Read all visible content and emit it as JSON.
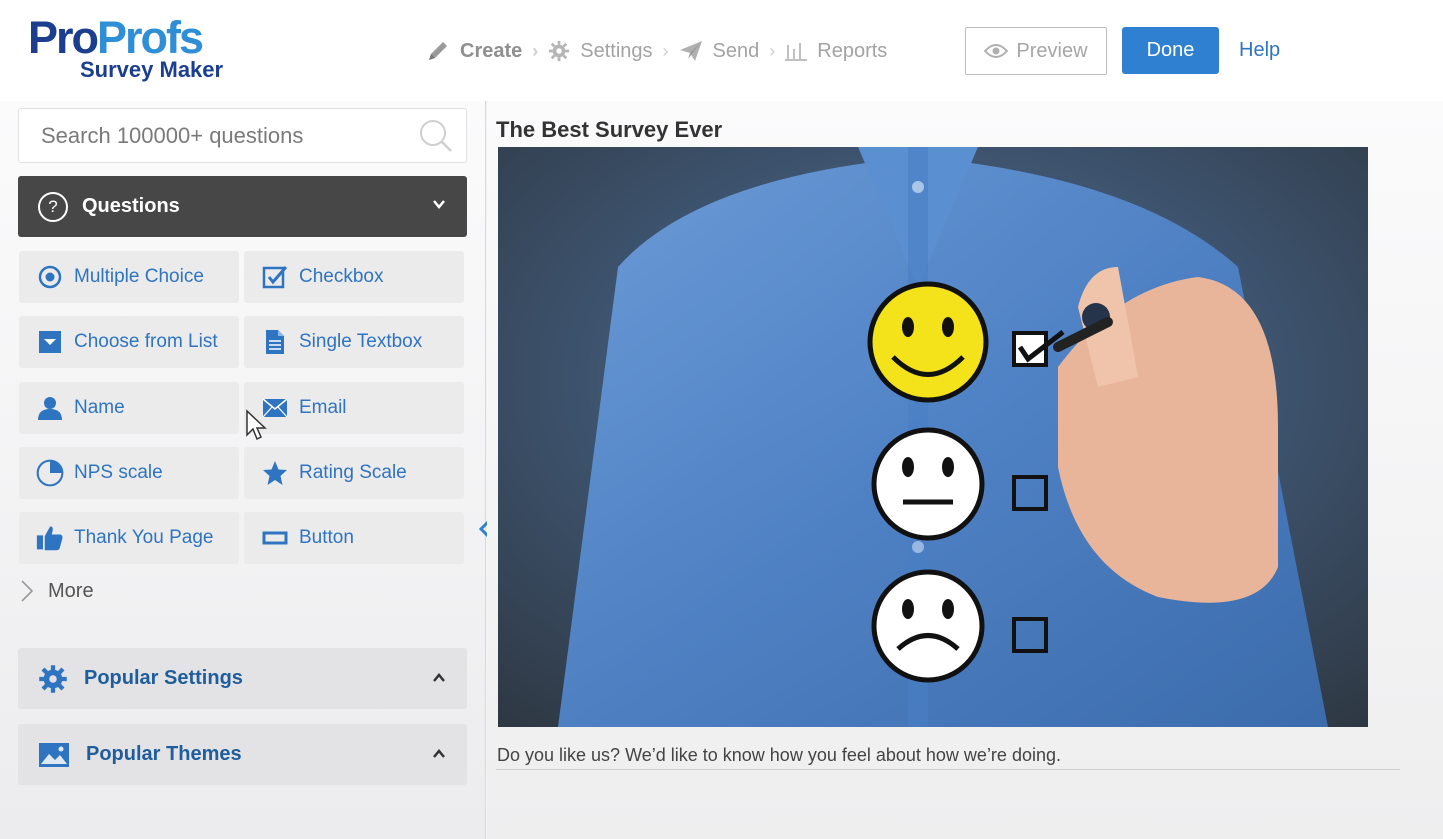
{
  "header": {
    "logo": {
      "brand_part1": "Pro",
      "brand_part2": "Profs",
      "product": "Survey Maker"
    },
    "nav": [
      {
        "label": "Create",
        "icon": "pencil-icon",
        "active": true
      },
      {
        "label": "Settings",
        "icon": "gear-icon",
        "active": false
      },
      {
        "label": "Send",
        "icon": "paper-plane-icon",
        "active": false
      },
      {
        "label": "Reports",
        "icon": "bar-chart-icon",
        "active": false
      }
    ],
    "preview_label": "Preview",
    "done_label": "Done",
    "help_label": "Help"
  },
  "sidebar": {
    "search": {
      "placeholder": "Search 100000+ questions",
      "value": ""
    },
    "questions_header": "Questions",
    "question_types": [
      {
        "label": "Multiple Choice",
        "icon": "radio-icon"
      },
      {
        "label": "Checkbox",
        "icon": "checkbox-icon"
      },
      {
        "label": "Choose from List",
        "icon": "dropdown-icon"
      },
      {
        "label": "Single Textbox",
        "icon": "document-icon"
      },
      {
        "label": "Name",
        "icon": "person-icon"
      },
      {
        "label": "Email",
        "icon": "envelope-icon"
      },
      {
        "label": "NPS scale",
        "icon": "pie-chart-icon"
      },
      {
        "label": "Rating Scale",
        "icon": "star-icon"
      },
      {
        "label": "Thank You Page",
        "icon": "thumbs-up-icon"
      },
      {
        "label": "Button",
        "icon": "button-icon"
      }
    ],
    "more_label": "More",
    "popular_settings_label": "Popular Settings",
    "popular_themes_label": "Popular Themes"
  },
  "main": {
    "survey_title": "The Best Survey Ever",
    "description": "Do you like us? We’d like to know how you feel about how we’re doing."
  },
  "colors": {
    "accent": "#2f80d0",
    "link": "#2f74c0",
    "dark_header": "#474747",
    "logo_dark": "#1c3e8f",
    "logo_light": "#2f8fd6"
  }
}
